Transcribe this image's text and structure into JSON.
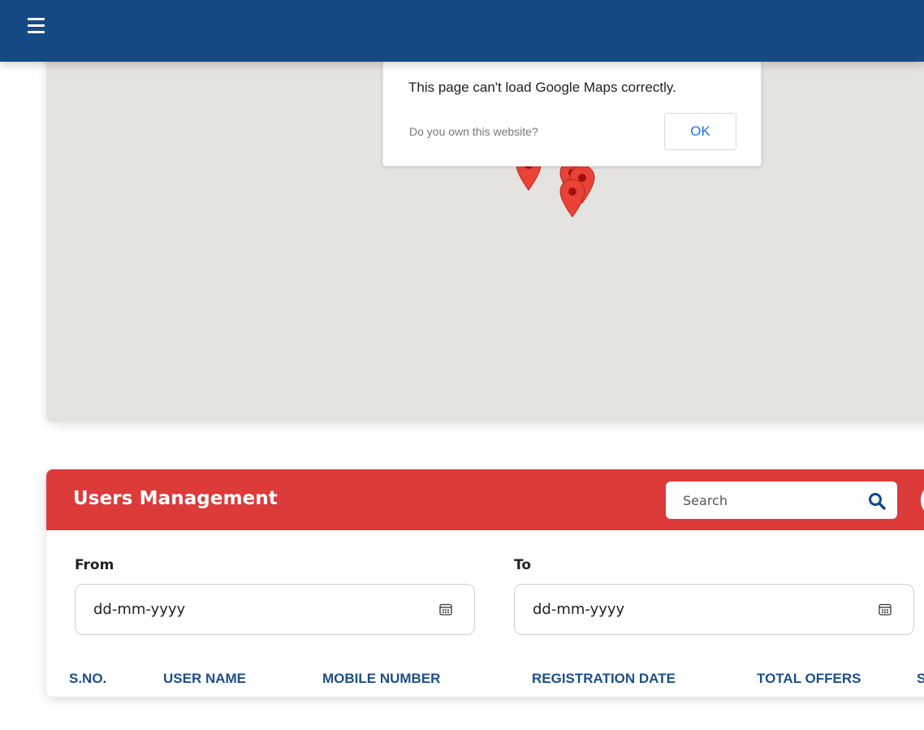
{
  "header": {
    "menu_icon": "hamburger-menu-icon",
    "color": "#154a84"
  },
  "map": {
    "dialog_message": "This page can't load Google Maps correctly.",
    "dialog_question": "Do you own this website?",
    "dialog_ok": "OK",
    "marker_icon": "map-marker-icon",
    "marker_count": 4
  },
  "users_management": {
    "title": "Users Management",
    "header_color": "#dc3b3a",
    "search": {
      "placeholder": "Search",
      "value": "",
      "icon": "search-icon"
    },
    "from": {
      "label": "From",
      "value": "dd-mm-yyyy",
      "icon": "calendar-icon"
    },
    "to": {
      "label": "To",
      "value": "dd-mm-yyyy",
      "icon": "calendar-icon"
    },
    "columns": [
      "S.NO.",
      "USER NAME",
      "MOBILE NUMBER",
      "REGISTRATION DATE",
      "TOTAL OFFERS",
      "S"
    ]
  }
}
